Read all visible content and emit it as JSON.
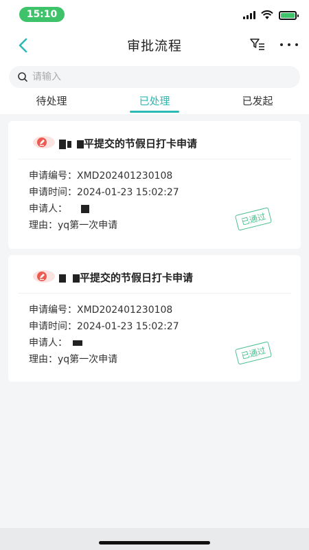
{
  "status_bar": {
    "time": "15:10",
    "accent_color": "#3ec26a"
  },
  "nav": {
    "title": "审批流程",
    "back_icon": "chevron-left-icon",
    "filter_icon": "filter-list-icon",
    "more_icon": "more-dots-icon"
  },
  "search": {
    "placeholder": "请输入",
    "value": ""
  },
  "tabs": [
    {
      "label": "待处理"
    },
    {
      "label": "已处理",
      "active": true
    },
    {
      "label": "已发起"
    }
  ],
  "accent_color": "#2cb8b3",
  "cards": [
    {
      "title_suffix": "平提交的节假日打卡申请",
      "number_label": "申请编号：",
      "number": "XMD202401230108",
      "time_label": "申请时间：",
      "time": "2024-01-23 15:02:27",
      "applicant_label": "申请人：",
      "reason_label": "理由：",
      "reason": "yq第一次申请",
      "status": "已通过"
    },
    {
      "title_suffix": "平提交的节假日打卡申请",
      "number_label": "申请编号：",
      "number": "XMD202401230108",
      "time_label": "申请时间：",
      "time": "2024-01-23 15:02:27",
      "applicant_label": "申请人：",
      "reason_label": "理由：",
      "reason": "yq第一次申请",
      "status": "已通过"
    }
  ]
}
